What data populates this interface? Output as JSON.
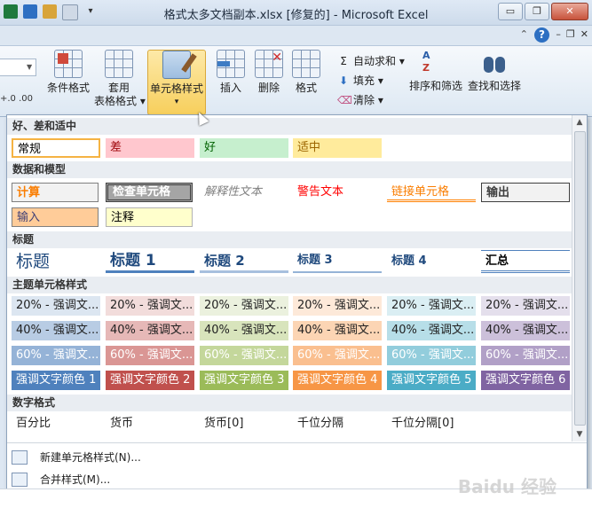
{
  "window": {
    "title": "格式太多文档副本.xlsx [修复的] - Microsoft Excel",
    "min": "▭",
    "max": "❐",
    "close": "✕"
  },
  "ribbon_small": {
    "help": "?",
    "collapse": "⌃",
    "min": "–",
    "restore": "❐",
    "close": "✕"
  },
  "ribbon": {
    "left_frag": "+.0 .00",
    "cond_format": "条件格式",
    "table_format": [
      "套用",
      "表格格式 ▾"
    ],
    "cell_styles": "单元格样式",
    "insert": "插入",
    "delete": "删除",
    "format": "格式",
    "autosum": "自动求和 ▾",
    "fill": "填充 ▾",
    "clear": "清除 ▾",
    "sort_filter": "排序和筛选",
    "find_select": "查找和选择"
  },
  "sections": {
    "good_bad": "好、差和适中",
    "data_model": "数据和模型",
    "titles": "标题",
    "themed": "主题单元格样式",
    "number": "数字格式"
  },
  "good_bad": [
    "常规",
    "差",
    "好",
    "适中"
  ],
  "data_model": [
    "计算",
    "检查单元格",
    "解释性文本",
    "警告文本",
    "链接单元格",
    "输出",
    "输入",
    "注释"
  ],
  "titles": [
    "标题",
    "标题 1",
    "标题 2",
    "标题 3",
    "标题 4",
    "汇总"
  ],
  "themed": {
    "row20": [
      "20% - 强调文...",
      "20% - 强调文...",
      "20% - 强调文...",
      "20% - 强调文...",
      "20% - 强调文...",
      "20% - 强调文..."
    ],
    "row40": [
      "40% - 强调文...",
      "40% - 强调文...",
      "40% - 强调文...",
      "40% - 强调文...",
      "40% - 强调文...",
      "40% - 强调文..."
    ],
    "row60": [
      "60% - 强调文...",
      "60% - 强调文...",
      "60% - 强调文...",
      "60% - 强调文...",
      "60% - 强调文...",
      "60% - 强调文..."
    ],
    "accent": [
      "强调文字颜色 1",
      "强调文字颜色 2",
      "强调文字颜色 3",
      "强调文字颜色 4",
      "强调文字颜色 5",
      "强调文字颜色 6"
    ]
  },
  "number": [
    "百分比",
    "货币",
    "货币[0]",
    "千位分隔",
    "千位分隔[0]"
  ],
  "menu": {
    "new_style": "新建单元格样式(N)...",
    "merge_style": "合并样式(M)..."
  },
  "watermark": "Baidu 经验",
  "colors": {
    "accent1": "#4f81bd",
    "accent2": "#c0504d",
    "accent3": "#9bbb59",
    "accent4": "#f79646",
    "accent5": "#4bacc6",
    "accent6": "#8064a2"
  }
}
